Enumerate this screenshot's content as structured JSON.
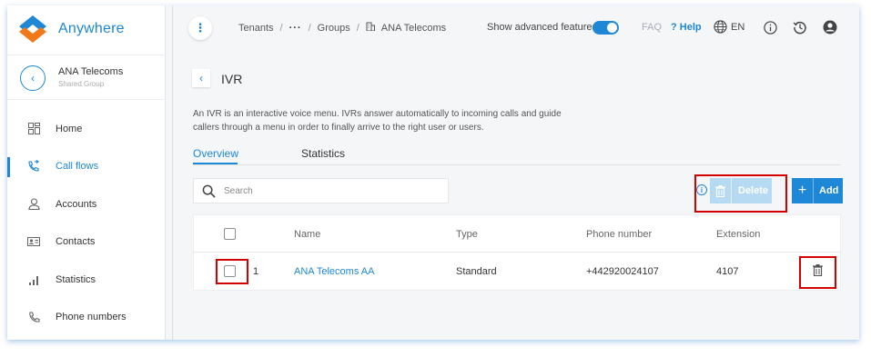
{
  "app": {
    "name": "Anywhere"
  },
  "tenant": {
    "name": "ANA Telecoms",
    "subtitle": "Shared.Group"
  },
  "sidebar": {
    "items": [
      {
        "label": "Home",
        "icon": "dashboard-icon",
        "active": false
      },
      {
        "label": "Call flows",
        "icon": "call-flow-icon",
        "active": true
      },
      {
        "label": "Accounts",
        "icon": "user-icon",
        "active": false
      },
      {
        "label": "Contacts",
        "icon": "contact-card-icon",
        "active": false
      },
      {
        "label": "Statistics",
        "icon": "bar-chart-icon",
        "active": false
      },
      {
        "label": "Phone numbers",
        "icon": "phone-icon",
        "active": false
      }
    ]
  },
  "topbar": {
    "breadcrumb": {
      "tenants": "Tenants",
      "more": "···",
      "groups": "Groups",
      "current": "ANA Telecoms"
    },
    "advanced_label": "Show advanced features",
    "advanced_on": true,
    "faq": "FAQ",
    "help": "? Help",
    "language": "EN"
  },
  "page": {
    "title": "IVR",
    "description": "An IVR is an interactive voice menu. IVRs answer automatically to incoming calls and guide callers through a menu in order to finally arrive to the right user or users.",
    "tabs": [
      {
        "label": "Overview",
        "active": true
      },
      {
        "label": "Statistics",
        "active": false
      }
    ]
  },
  "toolbar": {
    "search_placeholder": "Search",
    "delete_label": "Delete",
    "add_label": "Add"
  },
  "table": {
    "columns": [
      "Name",
      "Type",
      "Phone number",
      "Extension"
    ],
    "rows": [
      {
        "index": "1",
        "name": "ANA Telecoms AA",
        "type": "Standard",
        "phone": "+442920024107",
        "extension": "4107"
      }
    ]
  },
  "colors": {
    "accent": "#1e88d6",
    "highlight": "#d50000",
    "disabled_button": "#b6daf2"
  }
}
